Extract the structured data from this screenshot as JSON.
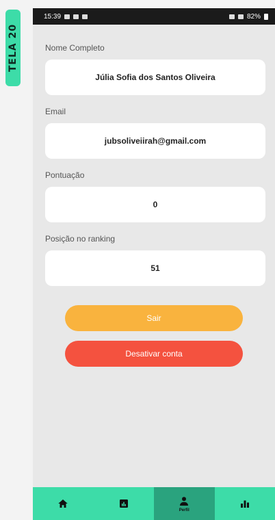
{
  "side_label": "TELA 20",
  "status_bar": {
    "time": "15:39",
    "battery": "82%"
  },
  "fields": [
    {
      "label": "Nome Completo",
      "value": "Júlia Sofia dos Santos Oliveira"
    },
    {
      "label": "Email",
      "value": "jubsoliveiirah@gmail.com"
    },
    {
      "label": "Pontuação",
      "value": "0"
    },
    {
      "label": "Posição no ranking",
      "value": "51"
    }
  ],
  "buttons": {
    "logout": "Sair",
    "deactivate": "Desativar conta"
  },
  "nav": {
    "items": [
      {
        "icon": "home-icon",
        "label": ""
      },
      {
        "icon": "report-icon",
        "label": ""
      },
      {
        "icon": "user-icon",
        "label": "Perfil",
        "active": true
      },
      {
        "icon": "ranking-icon",
        "label": ""
      }
    ]
  },
  "colors": {
    "accent": "#3ddca8",
    "nav_active": "#2aa37e",
    "logout_button": "#f9b33e",
    "deactivate_button": "#f4523f"
  }
}
